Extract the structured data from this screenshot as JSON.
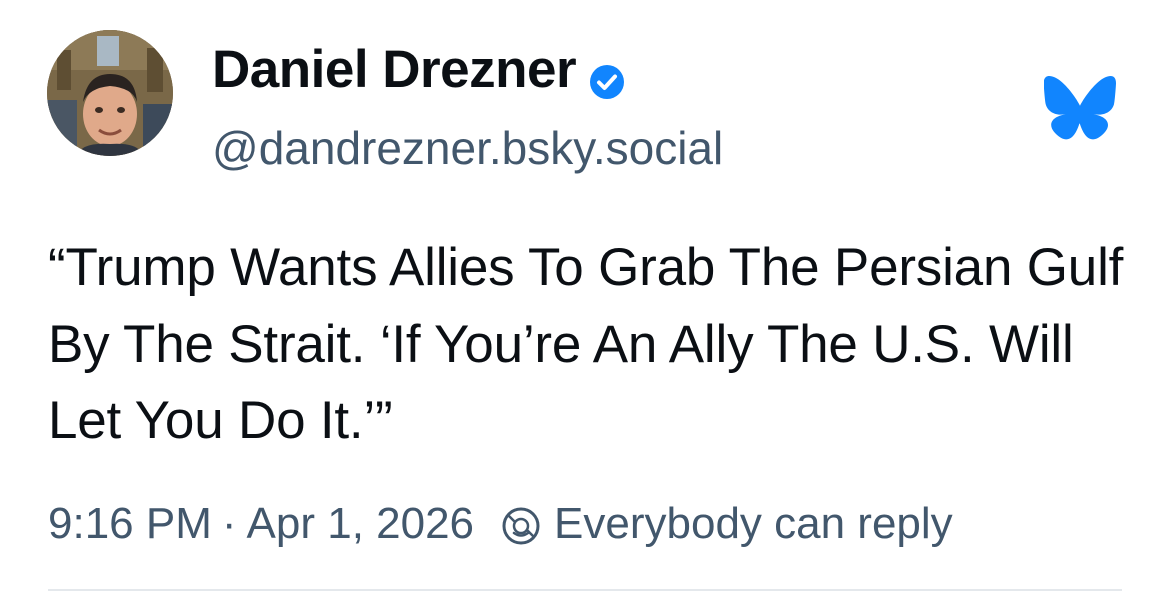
{
  "author": {
    "display_name": "Daniel Drezner",
    "handle": "@dandrezner.bsky.social",
    "verified": true,
    "avatar_icon": "user-avatar-photo"
  },
  "app": {
    "logo_icon": "bluesky-butterfly-icon",
    "brand_color": "#1185fe"
  },
  "post": {
    "text": "“Trump Wants Allies To Grab The Persian Gulf By The Strait. ‘If You’re An Ally The U.S. Will Let You Do It.’”"
  },
  "meta": {
    "time": "9:16 PM",
    "separator": "·",
    "date": "Apr 1, 2026",
    "reply_icon": "reply-settings-icon",
    "reply_setting": "Everybody can reply"
  },
  "colors": {
    "text": "#0b0f14",
    "secondary_text": "#42576c",
    "verified_badge": "#1185fe"
  }
}
